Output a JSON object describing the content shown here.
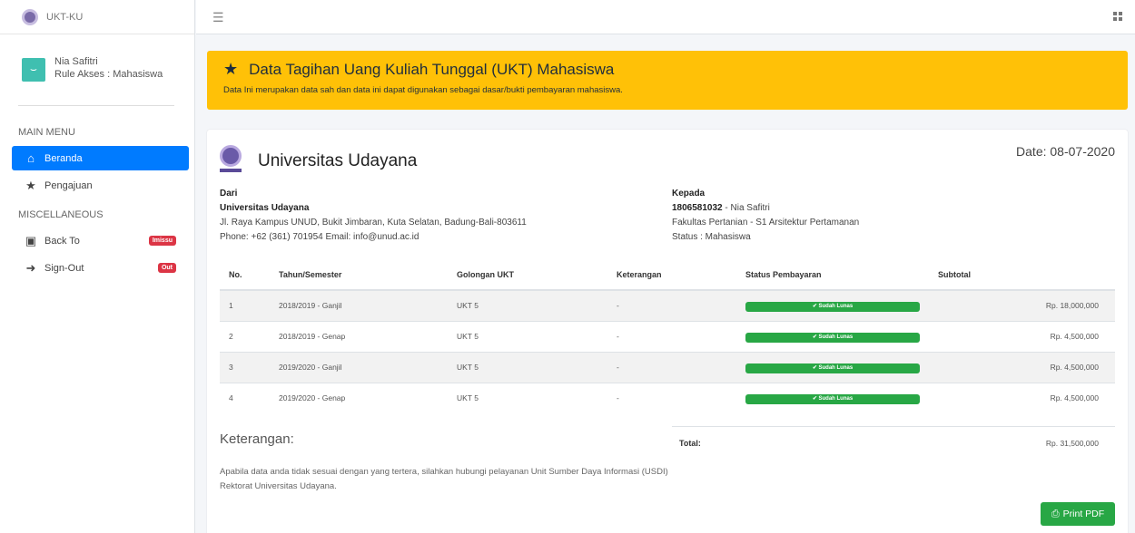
{
  "app": {
    "name": "UKT-KU"
  },
  "user": {
    "name": "Nia Safitri",
    "role": "Rule Akses : Mahasiswa"
  },
  "sidebar": {
    "main_header": "MAIN MENU",
    "misc_header": "MISCELLANEOUS",
    "items": [
      {
        "label": "Beranda",
        "icon": "home-icon"
      },
      {
        "label": "Pengajuan",
        "icon": "star-icon"
      },
      {
        "label": "Back To",
        "icon": "box-icon",
        "badge": "Imissu"
      },
      {
        "label": "Sign-Out",
        "icon": "sign-out-icon",
        "badge": "Out"
      }
    ]
  },
  "alert": {
    "title": "Data Tagihan Uang Kuliah Tunggal (UKT) Mahasiswa",
    "description": "Data Ini merupakan data sah dan data ini dapat digunakan sebagai dasar/bukti pembayaran mahasiswa."
  },
  "invoice": {
    "university": "Universitas Udayana",
    "date": "Date: 08-07-2020",
    "from": {
      "label": "Dari",
      "name": "Universitas Udayana",
      "address": "Jl. Raya Kampus UNUD, Bukit Jimbaran, Kuta Selatan, Badung-Bali-803611",
      "contact": "Phone: +62 (361) 701954 Email: info@unud.ac.id"
    },
    "to": {
      "label": "Kepada",
      "nim": "1806581032",
      "name": " - Nia Safitri",
      "faculty": "Fakultas Pertanian - S1 Arsitektur Pertamanan",
      "status": "Status : Mahasiswa"
    },
    "columns": [
      "No.",
      "Tahun/Semester",
      "Golongan UKT",
      "Keterangan",
      "Status Pembayaran",
      "Subtotal"
    ],
    "rows": [
      {
        "no": "1",
        "semester": "2018/2019 - Ganjil",
        "golongan": "UKT 5",
        "keterangan": "-",
        "status": "Sudah Lunas",
        "subtotal": "Rp. 18,000,000"
      },
      {
        "no": "2",
        "semester": "2018/2019 - Genap",
        "golongan": "UKT 5",
        "keterangan": "-",
        "status": "Sudah Lunas",
        "subtotal": "Rp. 4,500,000"
      },
      {
        "no": "3",
        "semester": "2019/2020 - Ganjil",
        "golongan": "UKT 5",
        "keterangan": "-",
        "status": "Sudah Lunas",
        "subtotal": "Rp. 4,500,000"
      },
      {
        "no": "4",
        "semester": "2019/2020 - Genap",
        "golongan": "UKT 5",
        "keterangan": "-",
        "status": "Sudah Lunas",
        "subtotal": "Rp. 4,500,000"
      }
    ],
    "note_title": "Keterangan:",
    "note_text": "Apabila data anda tidak sesuai dengan yang tertera, silahkan hubungi pelayanan Unit Sumber Daya Informasi (USDI) Rektorat Universitas Udayana.",
    "total_label": "Total:",
    "total_value": "Rp. 31,500,000",
    "print_label": "Print PDF"
  },
  "colors": {
    "primary": "#007bff",
    "warning": "#ffc107",
    "success": "#28a745",
    "danger": "#dc3545"
  }
}
